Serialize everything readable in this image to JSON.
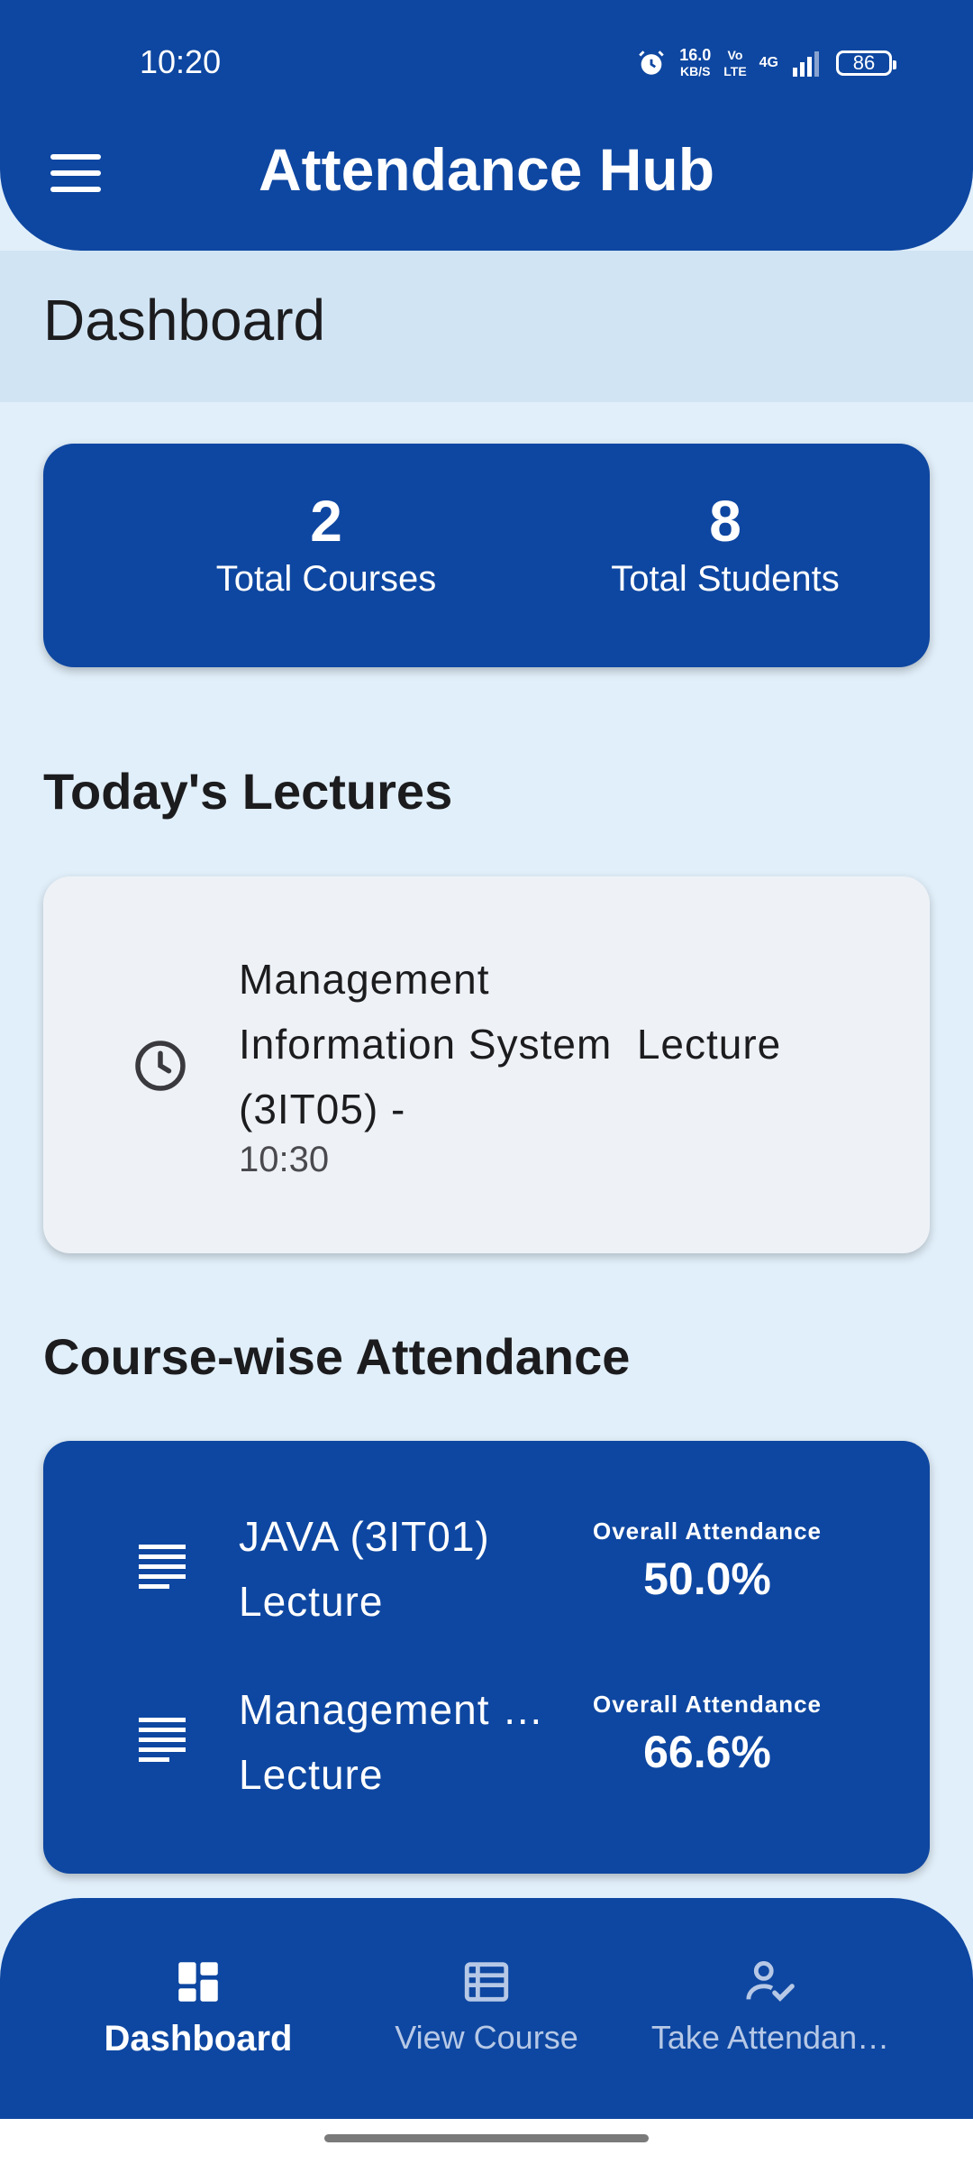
{
  "status_bar": {
    "time": "10:20",
    "net_speed_value": "16.0",
    "net_speed_unit": "KB/S",
    "volte_top": "Vo",
    "volte_bottom": "LTE",
    "network": "4G",
    "battery": "86"
  },
  "app_bar": {
    "title": "Attendance Hub"
  },
  "page": {
    "title": "Dashboard"
  },
  "stats": {
    "courses": {
      "value": "2",
      "label": "Total Courses"
    },
    "students": {
      "value": "8",
      "label": "Total Students"
    }
  },
  "todays_lectures": {
    "title": "Today's Lectures",
    "items": [
      {
        "line1": "Management",
        "line2": "Information System  Lecture",
        "line3": "(3IT05) -",
        "time": "10:30"
      }
    ]
  },
  "course_attendance": {
    "title": "Course-wise Attendance",
    "caption": "Overall Attendance",
    "items": [
      {
        "line1": "JAVA (3IT01)",
        "line2": "Lecture",
        "percent": "50.0%"
      },
      {
        "line1": "Management …",
        "line2": "Lecture",
        "percent": "66.6%"
      }
    ]
  },
  "bottom_nav": {
    "items": [
      {
        "label": "Dashboard",
        "icon": "dashboard-icon",
        "active": true
      },
      {
        "label": "View Course",
        "icon": "list-view-icon",
        "active": false
      },
      {
        "label": "Take Attendan…",
        "icon": "person-check-icon",
        "active": false
      }
    ]
  },
  "colors": {
    "primary": "#0e47a1",
    "background": "#e1effa",
    "header_band": "#d1e4f3",
    "card_light": "#eef2f7"
  }
}
